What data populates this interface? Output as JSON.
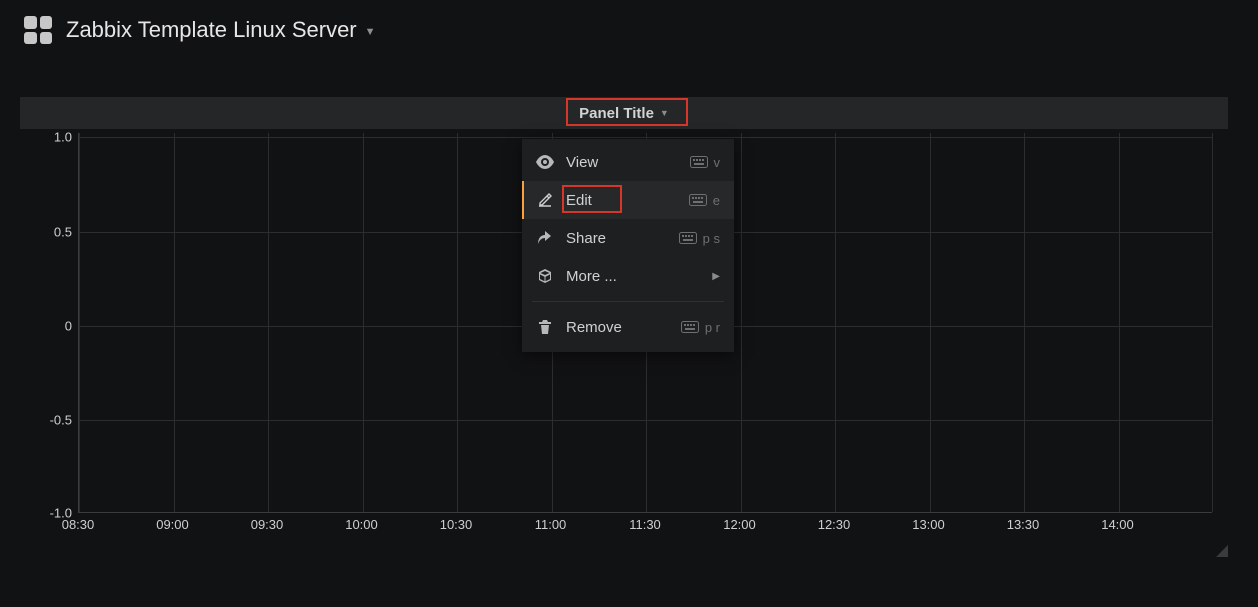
{
  "header": {
    "dashboard_title": "Zabbix Template Linux Server"
  },
  "panel": {
    "title": "Panel Title"
  },
  "chart_data": {
    "type": "line",
    "series": [],
    "x_ticks": [
      "08:30",
      "09:00",
      "09:30",
      "10:00",
      "10:30",
      "11:00",
      "11:30",
      "12:00",
      "12:30",
      "13:00",
      "13:30",
      "14:00"
    ],
    "y_ticks": [
      "1.0",
      "0.5",
      "0",
      "-0.5",
      "-1.0"
    ],
    "ylim": [
      -1.0,
      1.0
    ],
    "xlabel": "",
    "ylabel": "",
    "title": "Panel Title"
  },
  "menu": {
    "items": [
      {
        "label": "View",
        "shortcut": "v",
        "icon": "eye"
      },
      {
        "label": "Edit",
        "shortcut": "e",
        "icon": "pencil",
        "active": true
      },
      {
        "label": "Share",
        "shortcut": "p s",
        "icon": "share"
      },
      {
        "label": "More ...",
        "shortcut": "",
        "icon": "cube",
        "submenu": true
      }
    ],
    "remove": {
      "label": "Remove",
      "shortcut": "p r",
      "icon": "trash"
    }
  },
  "highlight": {
    "title_box": true,
    "edit_box": true
  }
}
